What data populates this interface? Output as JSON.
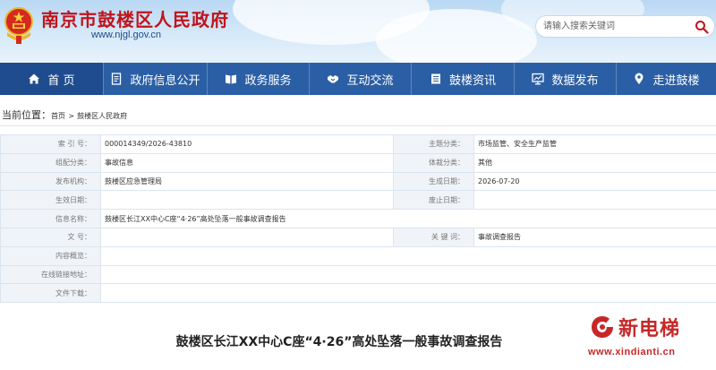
{
  "header": {
    "site_title": "南京市鼓楼区人民政府",
    "site_url": "www.njgl.gov.cn",
    "search_placeholder": "请输入搜索关键词"
  },
  "nav": [
    {
      "label": "首 页",
      "icon": "home-icon"
    },
    {
      "label": "政府信息公开",
      "icon": "document-icon"
    },
    {
      "label": "政务服务",
      "icon": "book-icon"
    },
    {
      "label": "互动交流",
      "icon": "handshake-icon"
    },
    {
      "label": "鼓楼资讯",
      "icon": "news-icon"
    },
    {
      "label": "数据发布",
      "icon": "monitor-icon"
    },
    {
      "label": "走进鼓楼",
      "icon": "location-pin-icon"
    }
  ],
  "breadcrumb": {
    "lead": "当前位置：",
    "home": "首页",
    "separator": ">",
    "current": "鼓楼区人民政府"
  },
  "info_table": {
    "index_label": "索 引 号：",
    "index_value": "000014349/2026-43810",
    "topic_label": "主题分类：",
    "topic_value": "市场监管、安全生产监管",
    "category_label": "组配分类：",
    "category_value": "事故信息",
    "genre_label": "体裁分类：",
    "genre_value": "其他",
    "publisher_label": "发布机构：",
    "publisher_value": "鼓楼区应急管理局",
    "generated_label": "生成日期：",
    "generated_value": "2026-07-20",
    "effective_label": "生效日期：",
    "effective_value": "",
    "abolished_label": "废止日期：",
    "abolished_value": "",
    "name_label": "信息名称：",
    "name_value": "鼓楼区长江XX中心C座“4·26”高处坠落一般事故调查报告",
    "docno_label": "文 号：",
    "docno_value": "",
    "keywords_label": "关 键 词：",
    "keywords_value": "事故调查报告",
    "summary_label": "内容概览：",
    "summary_value": "",
    "online_label": "在线链接地址：",
    "online_value": "",
    "download_label": "文件下载：",
    "download_value": ""
  },
  "article": {
    "title": "鼓楼区长江XX中心C座“4·26”高处坠落一般事故调查报告"
  },
  "watermark": {
    "name": "新电梯",
    "url": "www.xindianti.cn"
  },
  "colors": {
    "nav_bg": "#2b5fa5",
    "title_red": "#c0141c",
    "label_bg": "#f0f4f9",
    "border": "#dbe4ee"
  }
}
